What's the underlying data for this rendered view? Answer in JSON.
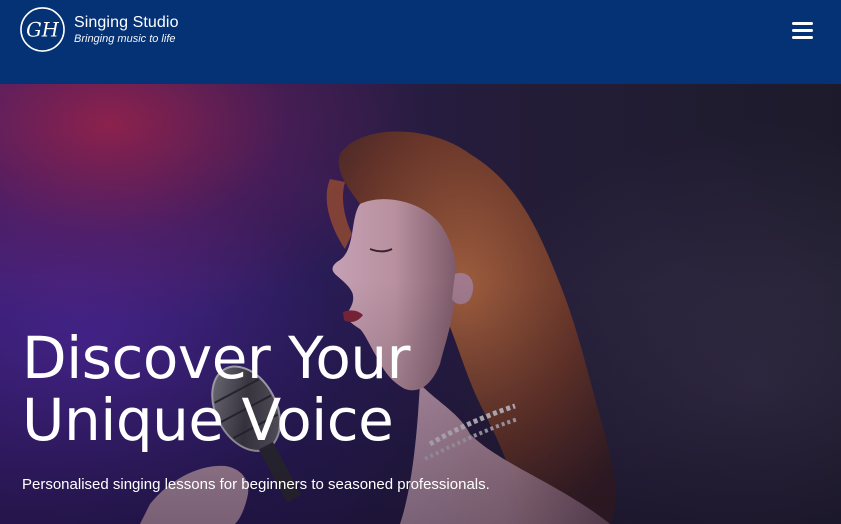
{
  "header": {
    "logo_monogram": "GH",
    "brand_name": "Singing Studio",
    "tagline": "Bringing music to life",
    "menu_icon": "hamburger-menu-icon"
  },
  "hero": {
    "image_icon": "singer-with-microphone-photo",
    "title_line1": "Discover Your",
    "title_line2": "Unique Voice",
    "subtitle": "Personalised singing lessons for beginners to seasoned professionals."
  },
  "colors": {
    "header_bg": "#053275",
    "text": "#ffffff"
  }
}
